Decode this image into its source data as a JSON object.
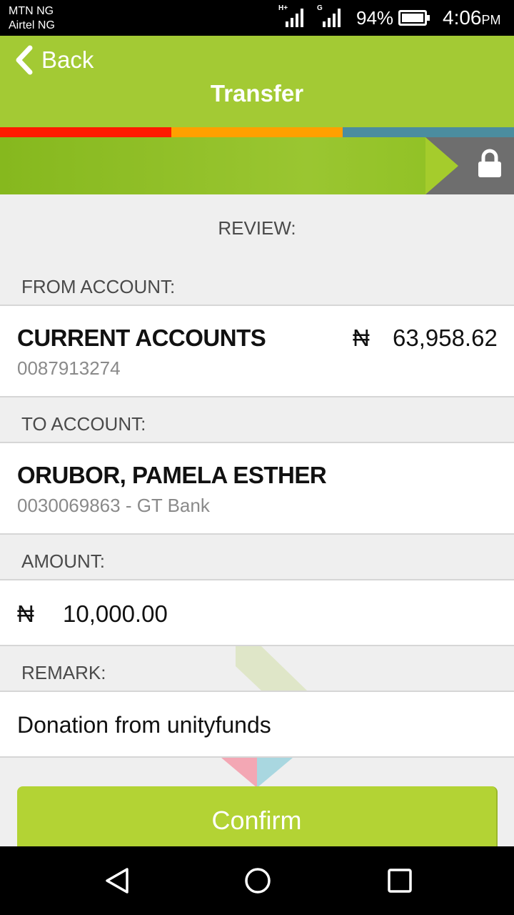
{
  "status_bar": {
    "carrier_1": "MTN NG",
    "carrier_2": "Airtel NG",
    "signal_1_type": "H+",
    "signal_2_type": "G",
    "battery": "94%",
    "time": "4:06",
    "ampm": "PM"
  },
  "header": {
    "back_label": "Back",
    "title": "Transfer"
  },
  "colors": {
    "brand_green": "#a3ca34",
    "confirm_green": "#b3d334",
    "stripe_red": "#ff1a00",
    "stripe_orange": "#ffa000",
    "stripe_teal": "#4b8d9f"
  },
  "review": {
    "heading": "REVIEW:",
    "from": {
      "label": "FROM ACCOUNT:",
      "account_name": "CURRENT ACCOUNTS",
      "account_number": "0087913274",
      "currency_symbol": "₦",
      "balance": "63,958.62"
    },
    "to": {
      "label": "TO ACCOUNT:",
      "name": "ORUBOR, PAMELA ESTHER",
      "details": "0030069863 - GT Bank"
    },
    "amount": {
      "label": "AMOUNT:",
      "currency_symbol": "₦",
      "value": "10,000.00"
    },
    "remark": {
      "label": "REMARK:",
      "value": "Donation from unityfunds"
    }
  },
  "actions": {
    "confirm_label": "Confirm"
  },
  "nav": {
    "back_icon": "triangle-back-icon",
    "home_icon": "circle-home-icon",
    "recents_icon": "square-recents-icon"
  }
}
